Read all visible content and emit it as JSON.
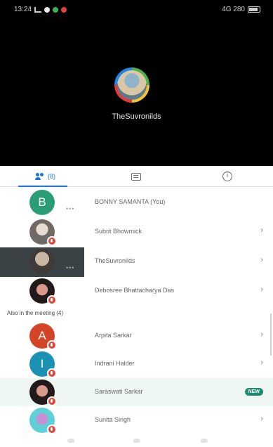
{
  "status_bar": {
    "time": "13:24",
    "left_text": "%",
    "right_text": "4G 280"
  },
  "host": {
    "name": "TheSuvronilds"
  },
  "tabs": {
    "people_count": "(8)"
  },
  "in_call": [
    {
      "name": "BONNY SAMANTA (You)",
      "avatar_letter": "B",
      "avatar_color": "#2a9d77"
    },
    {
      "name": "Subrit Bhowmick"
    },
    {
      "name": "TheSuvronilds"
    },
    {
      "name": "Debosree Bhattacharya Das"
    }
  ],
  "also_in_meeting": {
    "label": "Also in the meeting (4)",
    "items": [
      {
        "name": "Arpita Sarkar",
        "avatar_letter": "A",
        "avatar_color": "#d44426"
      },
      {
        "name": "Indrani Halder",
        "avatar_letter": "I",
        "avatar_color": "#1b91b3"
      },
      {
        "name": "Saraswati Sarkar",
        "badge": "NEW"
      },
      {
        "name": "Sunita Singh"
      }
    ]
  },
  "icons": {
    "people_tab": "people-icon",
    "chat_tab": "chat-icon",
    "info_tab": "info-icon",
    "mic_off": "mic-off-icon",
    "chevron": "chevron-right-icon"
  }
}
